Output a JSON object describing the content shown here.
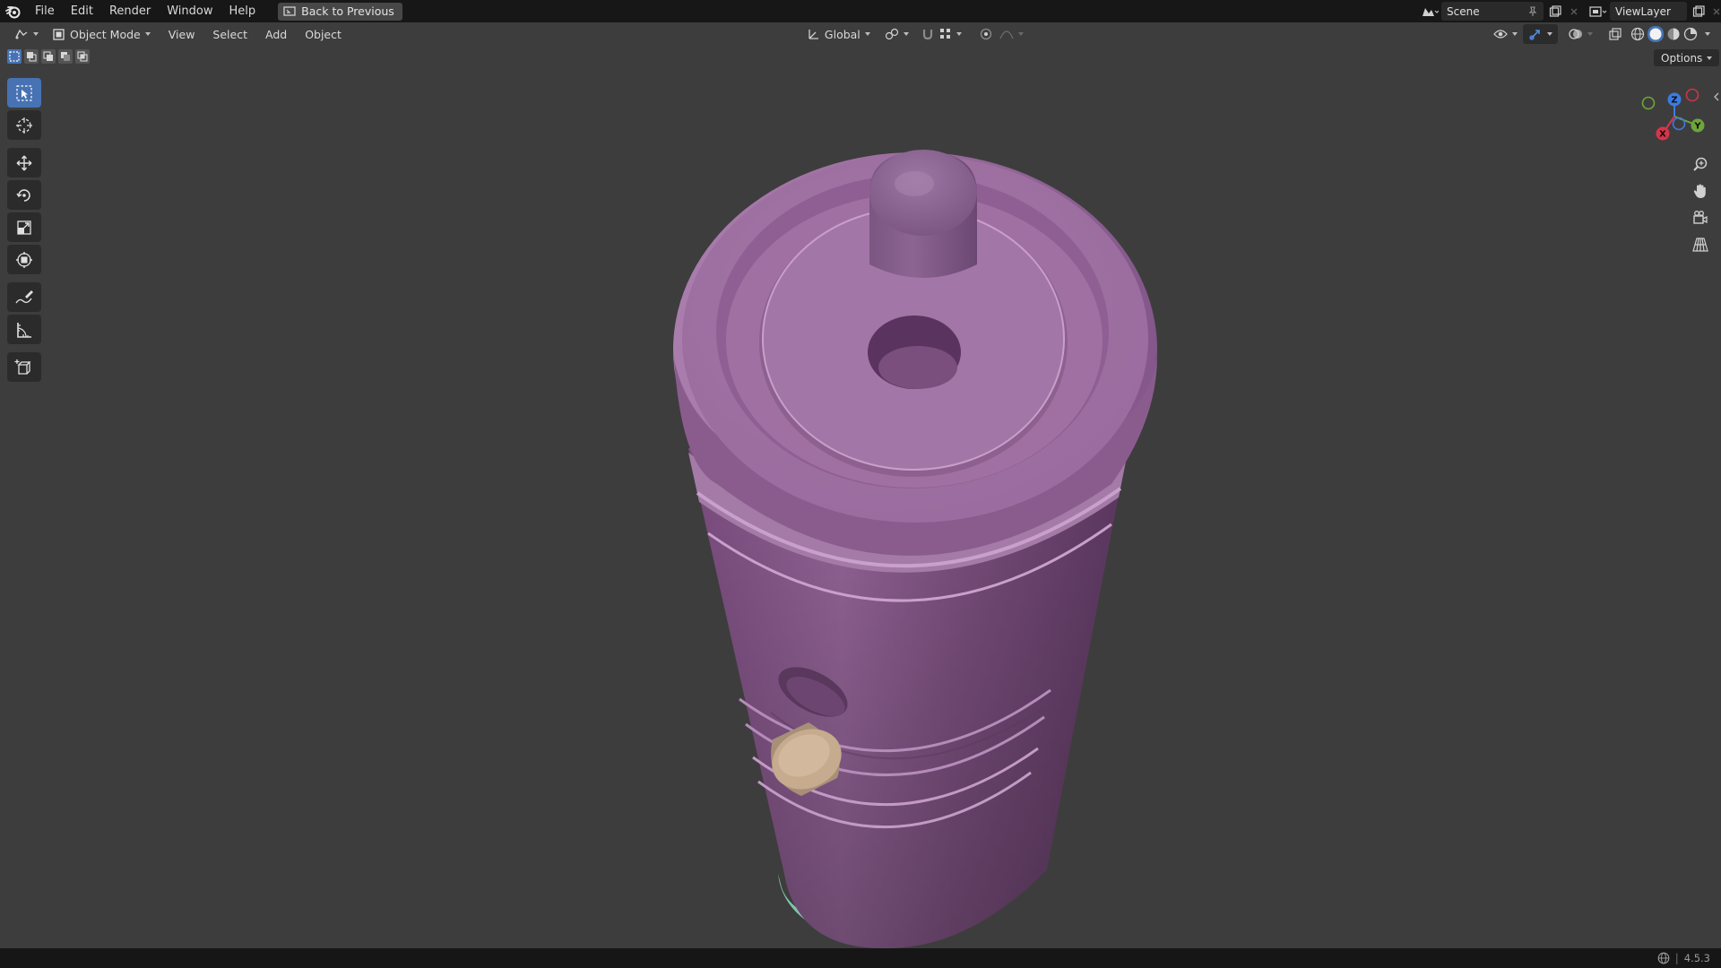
{
  "menu": {
    "items": [
      "File",
      "Edit",
      "Render",
      "Window",
      "Help"
    ],
    "back_label": "Back to Previous"
  },
  "scene": {
    "name": "Scene",
    "view_layer": "ViewLayer"
  },
  "header": {
    "mode": "Object Mode",
    "menus": [
      "View",
      "Select",
      "Add",
      "Object"
    ],
    "transform_orientation": "Global"
  },
  "options_label": "Options",
  "gizmo": {
    "x": "X",
    "y": "Y",
    "z": "Z"
  },
  "status": {
    "version": "4.5.3"
  },
  "colors": {
    "accent": "#4772b3",
    "object_body": "#9a6a9e",
    "knob": "#c6ab8e",
    "base_rim": "#7fc4aa",
    "viewport_bg": "#3d3d3d"
  }
}
